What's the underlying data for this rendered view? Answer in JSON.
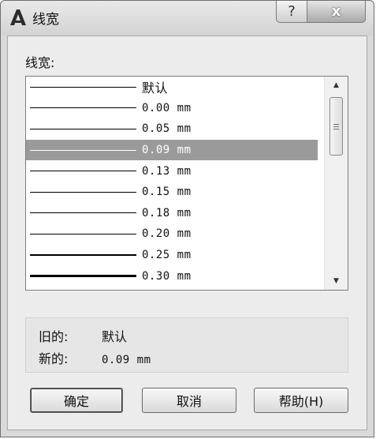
{
  "window": {
    "title": "线宽",
    "help_glyph": "?",
    "close_glyph": "x"
  },
  "lineweight_label": "线宽:",
  "list": {
    "items": [
      {
        "label": "默认",
        "thickness": 1,
        "selected": false
      },
      {
        "label": "0.00 mm",
        "thickness": 1,
        "selected": false
      },
      {
        "label": "0.05 mm",
        "thickness": 1,
        "selected": false
      },
      {
        "label": "0.09 mm",
        "thickness": 1,
        "selected": true
      },
      {
        "label": "0.13 mm",
        "thickness": 1,
        "selected": false
      },
      {
        "label": "0.15 mm",
        "thickness": 1,
        "selected": false
      },
      {
        "label": "0.18 mm",
        "thickness": 1,
        "selected": false
      },
      {
        "label": "0.20 mm",
        "thickness": 1.5,
        "selected": false
      },
      {
        "label": "0.25 mm",
        "thickness": 1.5,
        "selected": false
      },
      {
        "label": "0.30 mm",
        "thickness": 3,
        "selected": false
      }
    ],
    "scroll_up_glyph": "▲",
    "scroll_down_glyph": "▼"
  },
  "info": {
    "old_label": "旧的:",
    "old_value": "默认",
    "new_label": "新的:",
    "new_value": "0.09 mm"
  },
  "buttons": {
    "ok": "确定",
    "cancel": "取消",
    "help": "帮助(H)"
  },
  "colors": {
    "selection": "#9a9a9a",
    "dialog_bg": "#ececec"
  }
}
